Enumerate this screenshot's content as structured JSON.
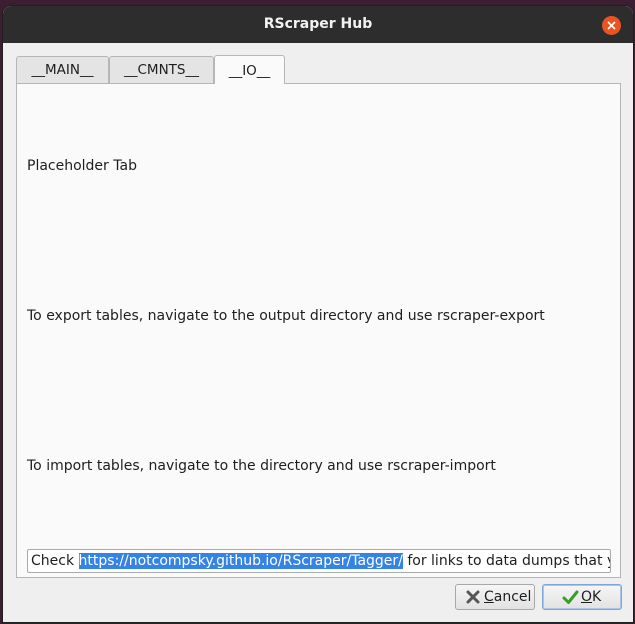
{
  "window": {
    "title": "RScraper Hub"
  },
  "tabs": [
    {
      "label": "__MAIN__"
    },
    {
      "label": "__CMNTS__"
    },
    {
      "label": "__IO__"
    }
  ],
  "panel": {
    "line1": "Placeholder Tab",
    "line2": "To export tables, navigate to the output directory and use rscraper-export",
    "line3": "To import tables, navigate to the directory and use rscraper-import",
    "link_field": {
      "prefix": "Check ",
      "selected_url": "https://notcompsky.github.io/RScraper/Tagger/",
      "suffix": " for links to data dumps that yo"
    }
  },
  "buttons": {
    "cancel": {
      "mnemonic": "C",
      "rest": "ancel"
    },
    "ok": {
      "mnemonic": "O",
      "rest": "K"
    }
  },
  "colors": {
    "titlebar": "#2d2d2d",
    "close_accent": "#e95420",
    "selection": "#3584e4",
    "ok_check": "#3a9c2b",
    "cancel_x": "#555555"
  },
  "icons": {
    "close": "close-icon",
    "cancel": "cancel-x-icon",
    "ok": "checkmark-icon"
  }
}
